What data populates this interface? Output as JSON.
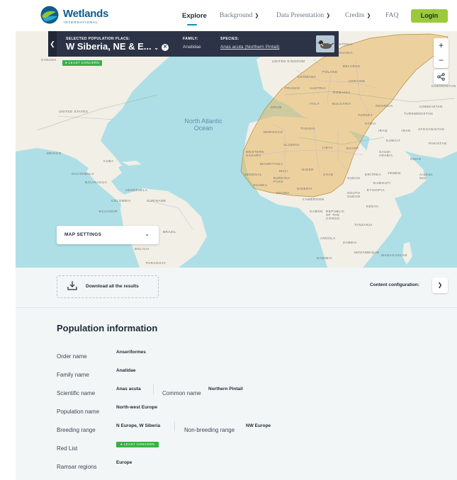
{
  "header": {
    "logo_text": "Wetlands",
    "logo_sub": "INTERNATIONAL",
    "nav": [
      {
        "label": "Explore",
        "active": true
      },
      {
        "label": "Background",
        "dropdown": true
      },
      {
        "label": "Data Presentation",
        "dropdown": true
      },
      {
        "label": "Credits",
        "dropdown": true
      },
      {
        "label": "FAQ",
        "dropdown": false
      }
    ],
    "login_label": "Login",
    "login_color": "#9bc93c"
  },
  "selection": {
    "place_caption": "SELECTED POPULATION PLACE:",
    "place_value": "W Siberia, NE & E...",
    "family_caption": "FAMILY:",
    "family_value": "Anatidae",
    "species_caption": "SPECIES:",
    "species_value": "Anas acuta (Northern Pintail)",
    "status_badge": "LEAST CONCERN"
  },
  "map": {
    "ocean_label": "North Atlantic Ocean",
    "country_labels": [
      "CANADA",
      "UNITED STATES",
      "MEXICO",
      "CUBA",
      "GUATEMALA",
      "NICARAGUA",
      "CARIBBEAN",
      "VENEZUELA",
      "COLOMBIA",
      "SURINAME",
      "ECUADOR",
      "BRAZIL",
      "BOLIVIA",
      "PARAGUAY",
      "UNITED KINGDOM",
      "GERMANY",
      "POLAND",
      "BELARUS",
      "UKRAINE",
      "FRANCE",
      "AUSTRIA",
      "ROMANIA",
      "SPAIN",
      "ITALY",
      "BULGARIA",
      "GEORGIA",
      "TURKEY",
      "TURKMENISTAN",
      "UZBEKISTAN",
      "KAZAKHSTAN",
      "AFGHANISTAN",
      "PAKISTAN",
      "IRAN",
      "IRAQ",
      "SYRIA",
      "KUWAIT",
      "SAUDI ARABIA",
      "OMAN",
      "YEMEN",
      "ERITREA",
      "DJIBOUTI",
      "SUDAN",
      "SOUTH SUDAN",
      "ETHIOPIA",
      "SOMALIA",
      "KENYA",
      "TANZANIA",
      "ANGOLA",
      "ZAMBIA",
      "NAMIBIA",
      "MOZAMBIQUE",
      "MADAGASCAR",
      "GABON",
      "REPUBLIC OF THE CONGO",
      "MOROCCO",
      "ALGERIA",
      "TUNISIA",
      "LIBYA",
      "EGYPT",
      "CHAD",
      "NIGER",
      "MALI",
      "MAURITANIA",
      "WESTERN SAHARA",
      "SENEGAL",
      "GUINEA",
      "BURKINA FASO",
      "GHANA",
      "NIGERIA",
      "CAMEROON",
      "ESTONIA",
      "LITHUANIA"
    ],
    "sea_label": "Arabian Sea",
    "settings_label": "MAP SETTINGS",
    "range_color": "#e8b865",
    "zoom_in": "+",
    "zoom_out": "−"
  },
  "toolbar": {
    "download_label": "Download all the results",
    "content_config_label": "Content configuration:"
  },
  "population": {
    "title": "Population information",
    "order_label": "Order name",
    "order_value": "Anseriformes",
    "family_label": "Family name",
    "family_value": "Anatidae",
    "scientific_label": "Scientific name",
    "scientific_value": "Anas acuta",
    "common_label": "Common name",
    "common_value": "Northern Pintail",
    "popname_label": "Population name",
    "popname_value": "North-west Europe",
    "breeding_label": "Breeding range",
    "breeding_value": "N Europe, W Siberia",
    "nonbreeding_label": "Non-breeding range",
    "nonbreeding_value": "NW Europe",
    "redlist_label": "Red List",
    "redlist_value": "LEAST CONCERN",
    "ramsar_label": "Ramsar regions",
    "ramsar_value": "Europe"
  }
}
